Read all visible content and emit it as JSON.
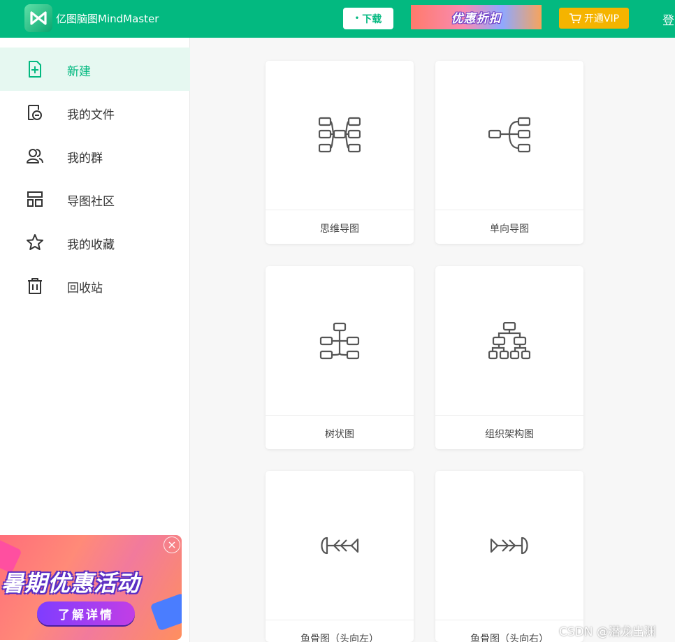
{
  "header": {
    "app_title": "亿图脑图MindMaster",
    "download_label": "下载",
    "promo_label": "优惠折扣",
    "vip_label": "开通VIP",
    "login_label": "登"
  },
  "sidebar": {
    "items": [
      {
        "label": "新建",
        "icon": "new-file-icon",
        "active": true
      },
      {
        "label": "我的文件",
        "icon": "my-files-icon"
      },
      {
        "label": "我的群",
        "icon": "group-icon"
      },
      {
        "label": "导图社区",
        "icon": "community-icon"
      },
      {
        "label": "我的收藏",
        "icon": "star-icon"
      },
      {
        "label": "回收站",
        "icon": "trash-icon"
      }
    ],
    "ad": {
      "title": "暑期优惠活动",
      "button": "了解详情"
    }
  },
  "templates": [
    {
      "label": "思维导图",
      "icon": "mind-map-icon"
    },
    {
      "label": "单向导图",
      "icon": "one-way-map-icon"
    },
    {
      "label": "树状图",
      "icon": "tree-chart-icon"
    },
    {
      "label": "组织架构图",
      "icon": "org-chart-icon"
    },
    {
      "label": "鱼骨图（头向左）",
      "icon": "fishbone-left-icon"
    },
    {
      "label": "鱼骨图（头向右）",
      "icon": "fishbone-right-icon"
    }
  ],
  "watermark": "CSDN @潜龙出渊",
  "colors": {
    "brand": "#03b980",
    "vip": "#f5b400",
    "active_bg": "#e6f8f1"
  }
}
